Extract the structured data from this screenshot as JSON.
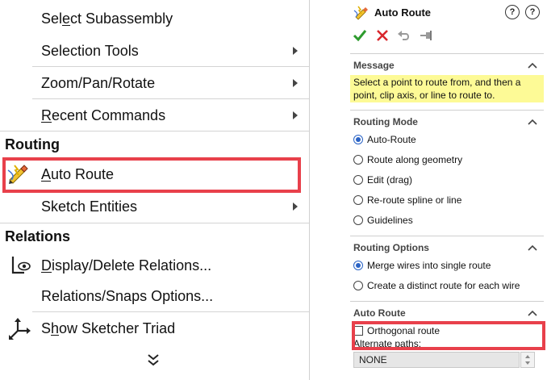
{
  "menu": {
    "items_top": [
      {
        "label": "Select Subassembly",
        "u": "l"
      },
      {
        "label": "Selection Tools",
        "submenu": true
      },
      {
        "label": "Zoom/Pan/Rotate",
        "submenu": true
      },
      {
        "label": "Recent Commands",
        "submenu": true,
        "u": "R"
      }
    ],
    "routing_header": "Routing",
    "routing_items": [
      {
        "label": "Auto Route",
        "icon": "auto-route-icon",
        "highlighted": true
      },
      {
        "label": "Sketch Entities",
        "submenu": true
      }
    ],
    "relations_header": "Relations",
    "relations_items": [
      {
        "label": "Display/Delete Relations...",
        "icon": "display-relations-icon"
      },
      {
        "label": "Relations/Snaps Options..."
      },
      {
        "label": "Show Sketcher Triad",
        "icon": "sketcher-triad-icon"
      }
    ],
    "more_icon": "double-chevron-down-icon"
  },
  "pm": {
    "title": "Auto Route",
    "help1": "?",
    "help2": "?",
    "msg_group": "Message",
    "message": "Select a point to route from, and then a point, clip axis, or line to route to.",
    "mode_group": "Routing Mode",
    "modes": [
      {
        "label": "Auto-Route",
        "selected": true
      },
      {
        "label": "Route along geometry",
        "selected": false
      },
      {
        "label": "Edit (drag)",
        "selected": false
      },
      {
        "label": "Re-route spline or line",
        "selected": false
      },
      {
        "label": "Guidelines",
        "selected": false
      }
    ],
    "options_group": "Routing Options",
    "options": [
      {
        "label": "Merge wires into single route",
        "selected": true
      },
      {
        "label": "Create a distinct route for each wire",
        "selected": false
      }
    ],
    "auto_group": "Auto Route",
    "orthogonal_label": "Orthogonal route",
    "orthogonal_checked": false,
    "alt_paths_label": "Alternate paths:",
    "alt_paths_value": "NONE"
  },
  "colors": {
    "highlight": "#e8404b",
    "message_bg": "#fdfa96",
    "ok": "#2e9b2e",
    "cancel": "#d9262c",
    "radio": "#2a63c5"
  }
}
